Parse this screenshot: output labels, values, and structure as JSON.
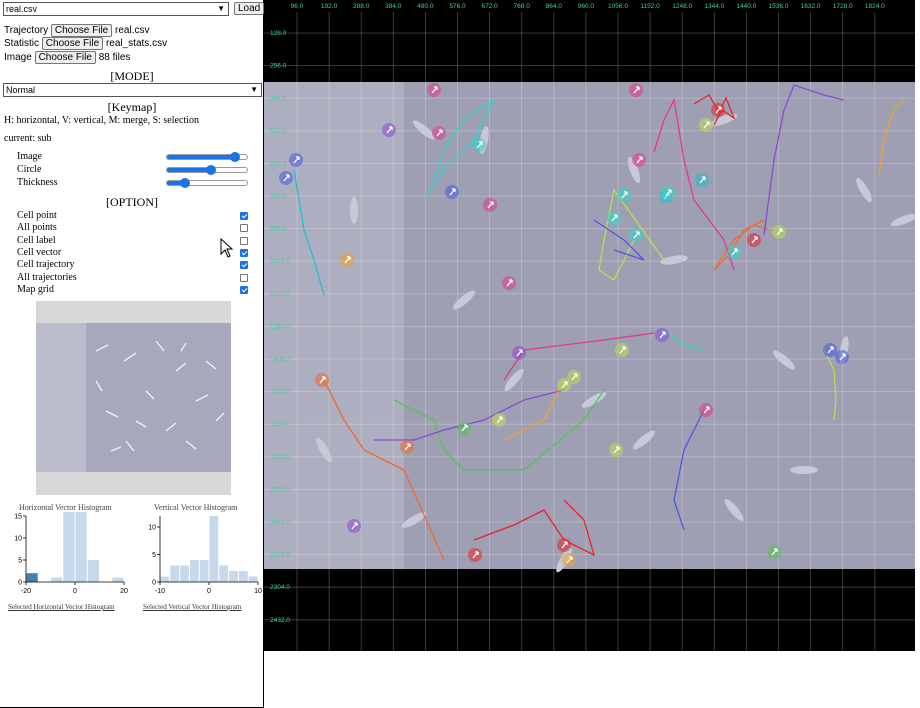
{
  "file_select": {
    "value": "real.csv"
  },
  "load_button": "Load",
  "files": {
    "trajectory": {
      "label": "Trajectory",
      "button": "Choose File",
      "value": "real.csv"
    },
    "statistic": {
      "label": "Statistic",
      "button": "Choose File",
      "value": "real_stats.csv"
    },
    "image": {
      "label": "Image",
      "button": "Choose File",
      "value": "88 files"
    }
  },
  "mode": {
    "header": "[MODE]",
    "value": "Normal"
  },
  "keymap": {
    "header": "[Keymap]",
    "text": "H: horizontal, V: vertical, M: merge, S: selection",
    "current": "current: sub"
  },
  "sliders": [
    {
      "label": "Image",
      "value": 0.85
    },
    {
      "label": "Circle",
      "value": 0.55
    },
    {
      "label": "Thickness",
      "value": 0.22
    }
  ],
  "option": {
    "header": "[OPTION]",
    "items": [
      {
        "label": "Cell point",
        "checked": true
      },
      {
        "label": "All points",
        "checked": false
      },
      {
        "label": "Cell label",
        "checked": false
      },
      {
        "label": "Cell vector",
        "checked": true
      },
      {
        "label": "Cell trajectory",
        "checked": true
      },
      {
        "label": "All trajectories",
        "checked": false
      },
      {
        "label": "Map grid",
        "checked": true
      }
    ]
  },
  "histograms": {
    "horizontal": {
      "title": "Horizontal Vector Histogram",
      "link": "Selected Horizontal Vector Histogram",
      "x_ticks": [
        "-20",
        "0",
        "20"
      ],
      "y_ticks": [
        "0",
        "5",
        "10",
        "15"
      ],
      "xlim": [
        -20,
        20
      ],
      "ylim": [
        0,
        15
      ],
      "bins": [
        {
          "x0": -20,
          "x1": -15,
          "count": 2
        },
        {
          "x0": -15,
          "x1": -10,
          "count": 0
        },
        {
          "x0": -10,
          "x1": -5,
          "count": 1
        },
        {
          "x0": -5,
          "x1": 0,
          "count": 16
        },
        {
          "x0": 0,
          "x1": 5,
          "count": 16
        },
        {
          "x0": 5,
          "x1": 10,
          "count": 5
        },
        {
          "x0": 10,
          "x1": 15,
          "count": 0
        },
        {
          "x0": 15,
          "x1": 20,
          "count": 1
        }
      ],
      "selected_bins": [
        0
      ],
      "bar_color": "#c6d9ea",
      "selected_color": "#4a7fa7"
    },
    "vertical": {
      "title": "Vertical Vector Histogram",
      "link": "Selected Vertical Vector Histogram",
      "x_ticks": [
        "-10",
        "0",
        "10"
      ],
      "y_ticks": [
        "0",
        "5",
        "10"
      ],
      "xlim": [
        -10,
        10
      ],
      "ylim": [
        0,
        12
      ],
      "bins": [
        {
          "x0": -10,
          "x1": -8,
          "count": 1
        },
        {
          "x0": -8,
          "x1": -6,
          "count": 3
        },
        {
          "x0": -6,
          "x1": -4,
          "count": 3
        },
        {
          "x0": -4,
          "x1": -2,
          "count": 4
        },
        {
          "x0": -2,
          "x1": 0,
          "count": 4
        },
        {
          "x0": 0,
          "x1": 2,
          "count": 12
        },
        {
          "x0": 2,
          "x1": 4,
          "count": 3
        },
        {
          "x0": 4,
          "x1": 6,
          "count": 2
        },
        {
          "x0": 6,
          "x1": 8,
          "count": 2
        },
        {
          "x0": 8,
          "x1": 10,
          "count": 1
        }
      ],
      "bar_color": "#c6d9ea"
    }
  },
  "map": {
    "x_ticks": [
      "96.0",
      "192.0",
      "288.0",
      "384.0",
      "480.0",
      "576.0",
      "672.0",
      "768.0",
      "864.0",
      "960.0",
      "1056.0",
      "1152.0",
      "1248.0",
      "1344.0",
      "1440.0",
      "1536.0",
      "1632.0",
      "1728.0",
      "1824.0"
    ],
    "y_ticks": [
      "128.0",
      "256.0",
      "384.0",
      "512.0",
      "640.0",
      "768.0",
      "896.0",
      "1024.0",
      "1152.0",
      "1280.0",
      "1408.0",
      "1536.0",
      "1664.0",
      "1792.0",
      "1920.0",
      "2048.0",
      "2176.0",
      "2304.0",
      "2432.0"
    ],
    "tick_color": "#3fd0a0",
    "image_color": "#9e9fb3",
    "trajectory_colors": [
      "#e8232b",
      "#f06a2e",
      "#e4388a",
      "#2ed8c8",
      "#b8e04a",
      "#8a4ad0",
      "#4a5ae0",
      "#f0a030",
      "#20c0d0",
      "#5ac05a"
    ]
  }
}
